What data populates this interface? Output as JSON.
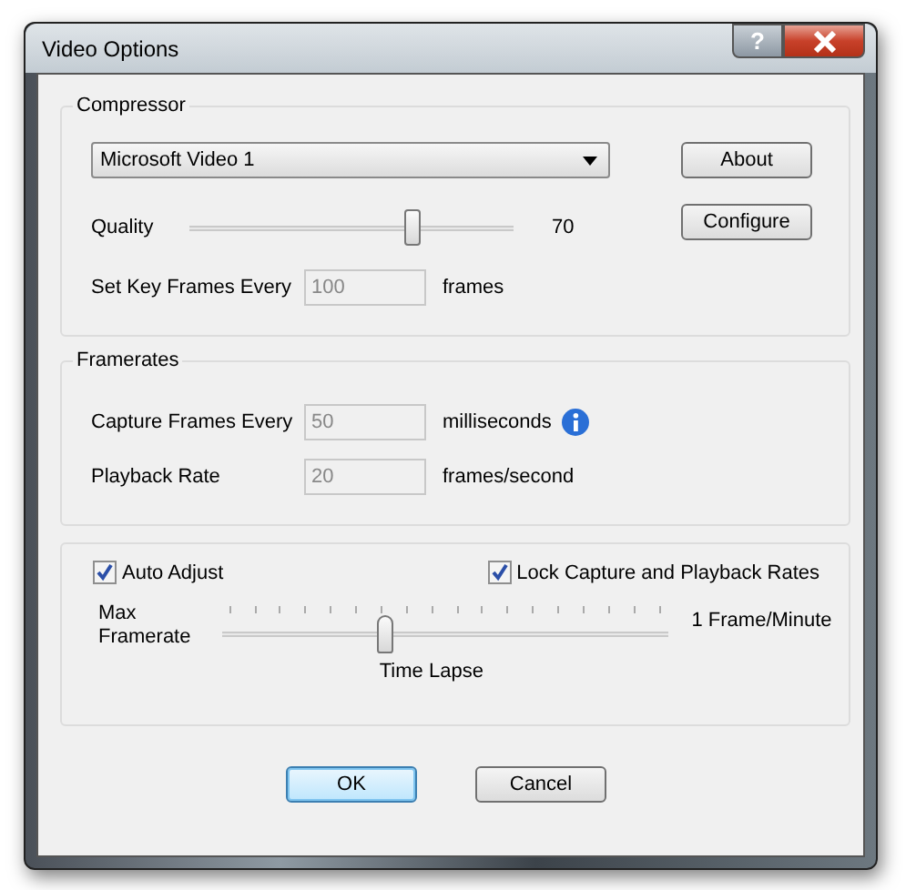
{
  "window": {
    "title": "Video Options",
    "help_button": "?"
  },
  "compressor": {
    "legend": "Compressor",
    "codec": "Microsoft Video 1",
    "quality_label": "Quality",
    "quality": {
      "level": 0.69
    },
    "quality_reading": "70",
    "key_frames_label": "Set Key Frames Every",
    "key_frames": {
      "value": "100",
      "disabled": true
    },
    "key_frames_unit": "frames",
    "buttons": [
      "About",
      "Configure"
    ]
  },
  "framerates": {
    "legend": "Framerates",
    "rows": [
      {
        "label": "Capture Frames Every",
        "value": "50",
        "disabled": true,
        "unit": "milliseconds",
        "info": true
      },
      {
        "label": "Playback Rate",
        "value": "20",
        "disabled": true,
        "unit": "frames/second",
        "info": false
      }
    ]
  },
  "rate_panel": {
    "checkboxes": [
      {
        "label": "Auto Adjust",
        "checked": true
      },
      {
        "label": "Lock Capture and Playback Rates",
        "checked": true
      }
    ],
    "max_label": "Max Framerate",
    "slider": {
      "level": 0.37
    },
    "right_label": "1 Frame/Minute",
    "below_label": "Time Lapse"
  },
  "buttons": [
    {
      "label": "OK",
      "selected": true
    },
    {
      "label": "Cancel",
      "selected": false
    }
  ]
}
